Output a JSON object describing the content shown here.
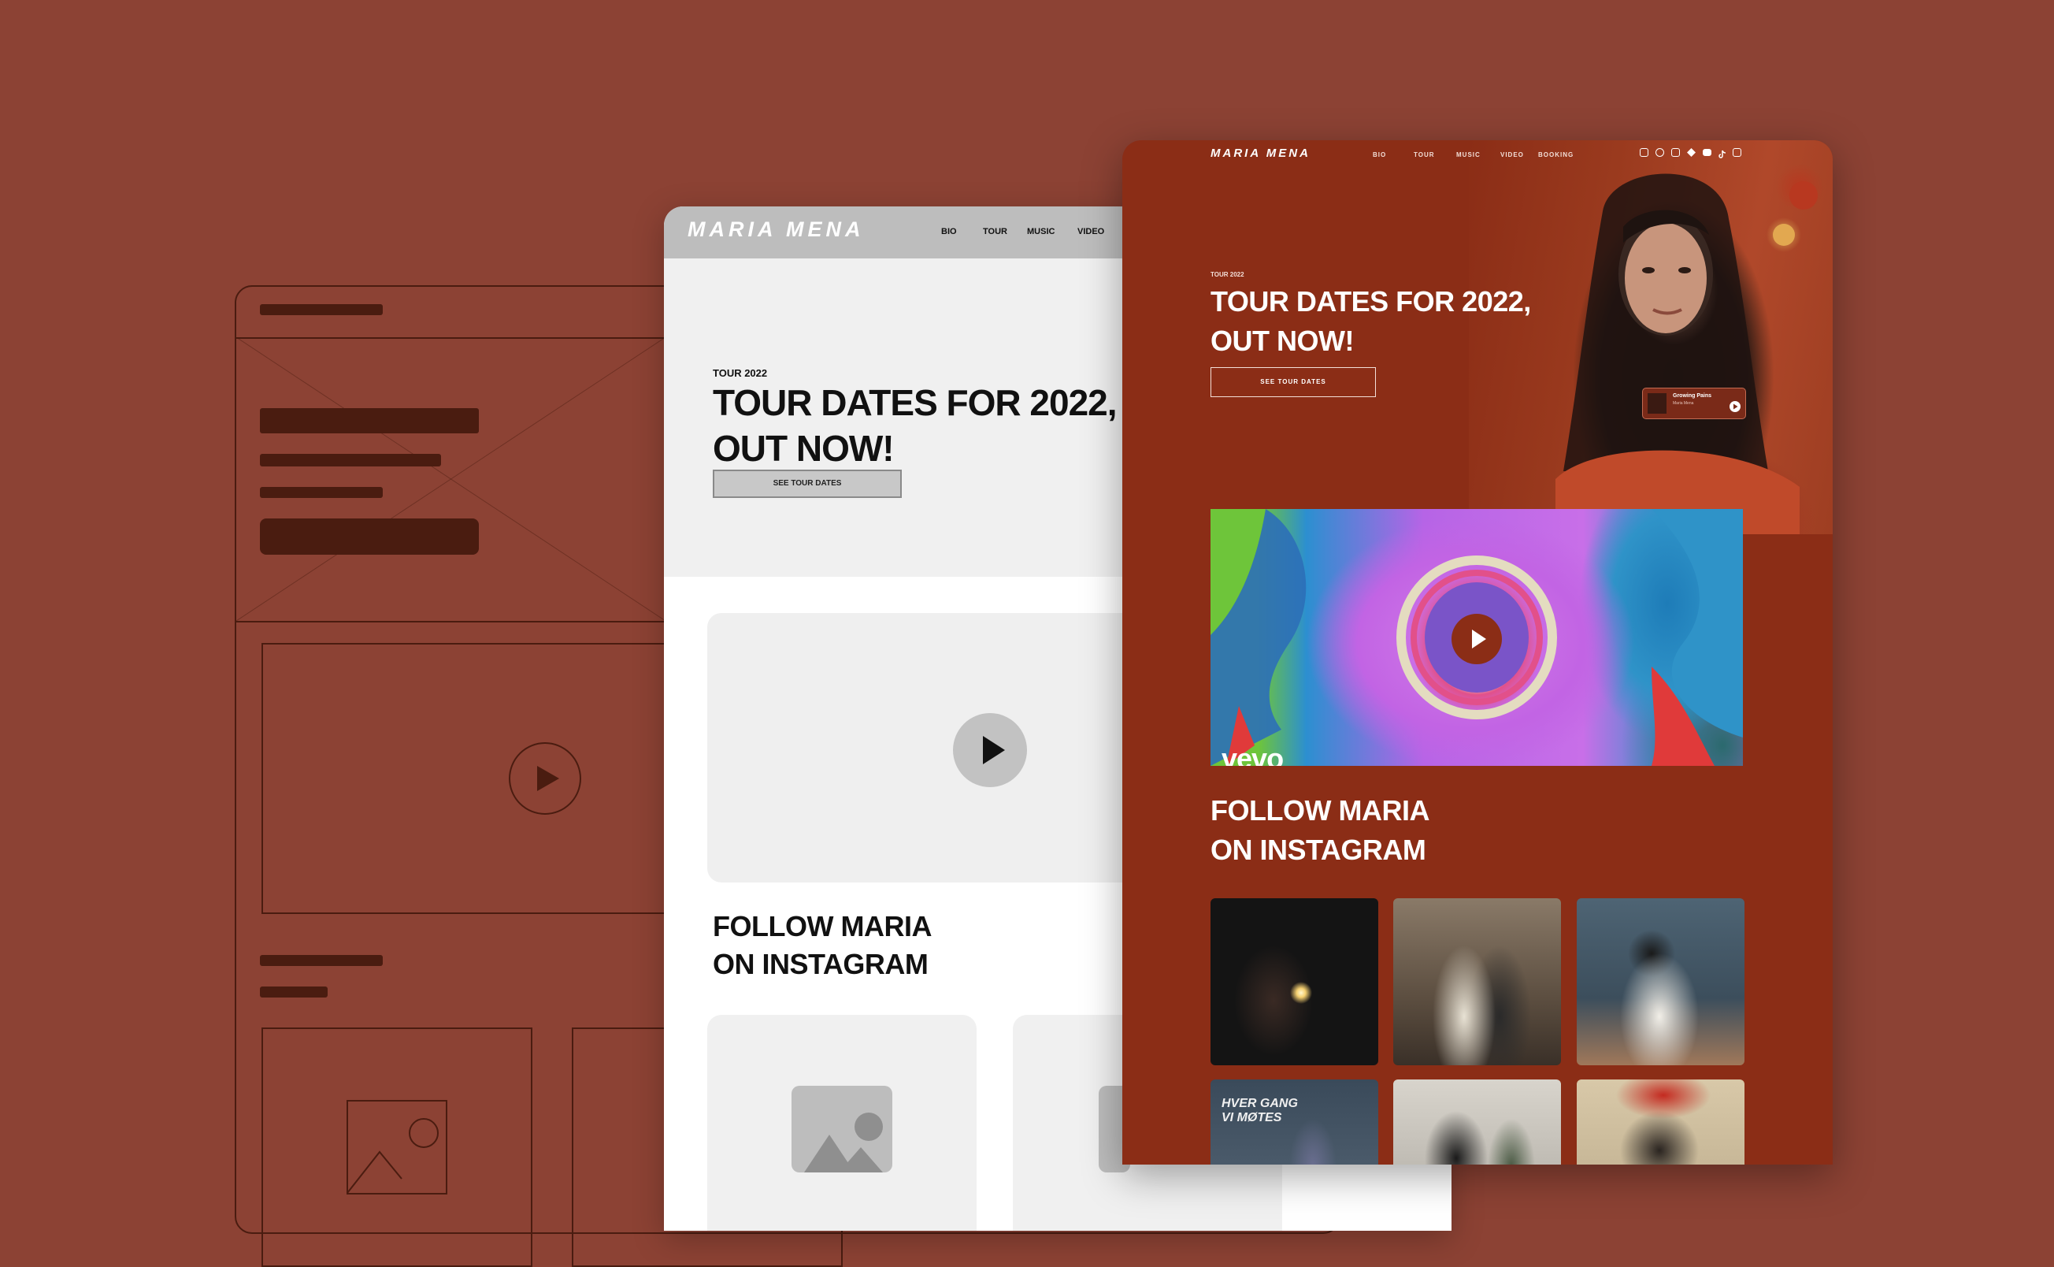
{
  "colors": {
    "background": "#8c4234",
    "wireframe_line": "#4a1c10",
    "grey_nav": "#bdbdbd",
    "grey_hero": "#f0f0f0",
    "site_bg": "#8b2d16",
    "white": "#ffffff"
  },
  "grey_mock": {
    "logo": "MARIA MENA",
    "nav": [
      "BIO",
      "TOUR",
      "MUSIC",
      "VIDEO"
    ],
    "eyebrow": "TOUR 2022",
    "title_line1": "TOUR DATES FOR 2022,",
    "title_line2": "OUT NOW!",
    "button": "SEE TOUR DATES",
    "follow_line1": "FOLLOW MARIA",
    "follow_line2": "ON INSTAGRAM",
    "play_icon": "play-icon",
    "image_icon": "image-placeholder-icon"
  },
  "site": {
    "logo": "MARIA MENA",
    "nav": [
      "BIO",
      "TOUR",
      "MUSIC",
      "VIDEO",
      "BOOKING"
    ],
    "social_icons": [
      "instagram-icon",
      "spotify-icon",
      "apple-music-icon",
      "tidal-icon",
      "youtube-icon",
      "tiktok-icon",
      "facebook-icon"
    ],
    "eyebrow": "TOUR 2022",
    "title_line1": "TOUR DATES FOR 2022,",
    "title_line2": "OUT NOW!",
    "button": "SEE TOUR DATES",
    "player": {
      "title": "Growing Pains",
      "artist": "Maria Mena"
    },
    "video_brand": "vevo",
    "follow_line1": "FOLLOW MARIA",
    "follow_line2": "ON INSTAGRAM",
    "instagram_post_text": "HVER GANG VI MØTES"
  }
}
